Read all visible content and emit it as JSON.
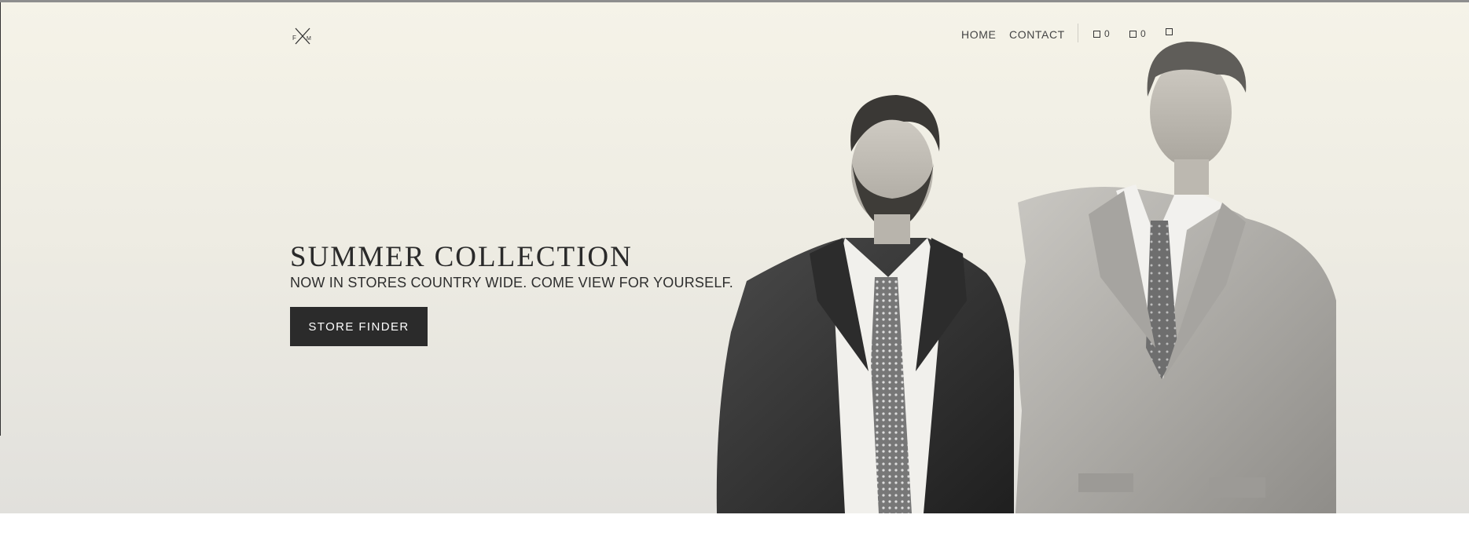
{
  "brand": {
    "logo_left": "F",
    "logo_right": "M"
  },
  "nav": {
    "links": [
      {
        "label": "HOME"
      },
      {
        "label": "CONTACT"
      }
    ],
    "counters": [
      {
        "icon": "square-icon",
        "count": "0"
      },
      {
        "icon": "square-icon",
        "count": "0"
      },
      {
        "icon": "square-icon",
        "count": ""
      }
    ]
  },
  "hero": {
    "title": "SUMMER COLLECTION",
    "subtitle": "NOW IN STORES COUNTRY WIDE. COME VIEW FOR YOURSELF.",
    "cta_label": "STORE FINDER",
    "image": "two men in suits, black and white photo"
  },
  "colors": {
    "hero_background_top": "#f5f3e8",
    "hero_background_bottom": "#e1e0dc",
    "button_background": "#2b2b2b",
    "button_text": "#ffffff",
    "text_dark": "#2a2a2a"
  }
}
